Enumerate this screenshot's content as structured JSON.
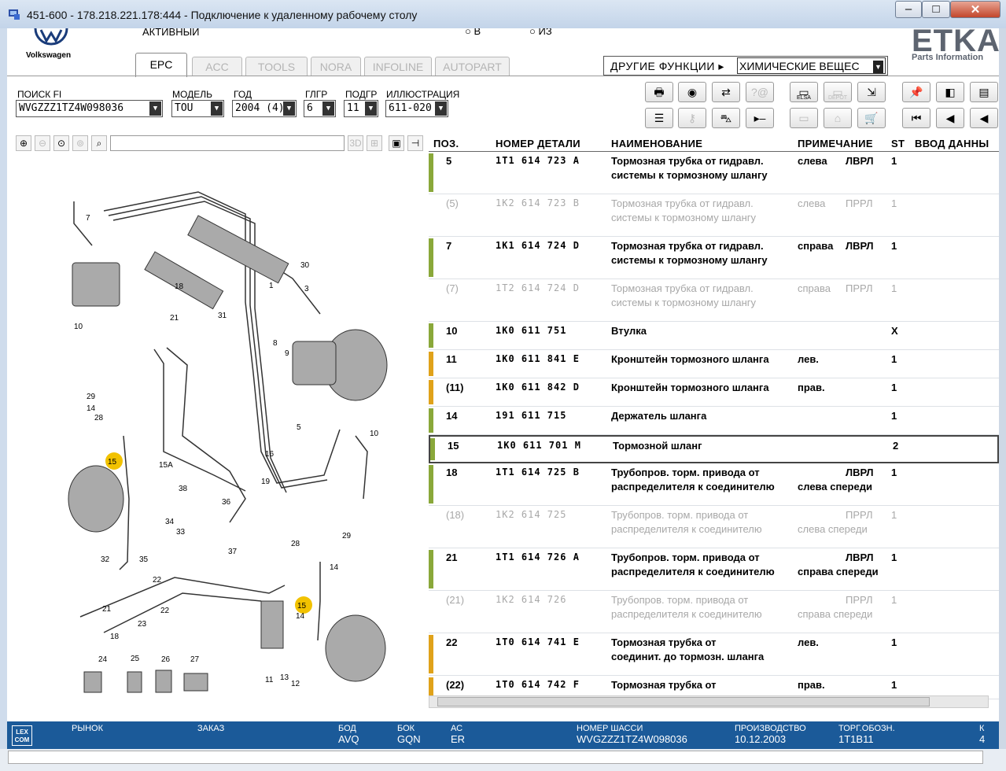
{
  "window": {
    "title": "451-600 - 178.218.221.178:444 - Подключение к удаленному рабочему столу"
  },
  "brand": {
    "name": "Volkswagen",
    "status": "АКТИВНЫЙ",
    "radio_a": "В",
    "radio_b": "ИЗ"
  },
  "etka": {
    "logo": "ETKA",
    "subtitle": "Parts Information"
  },
  "tabs": [
    "EPC",
    "ACC",
    "TOOLS",
    "NORA",
    "INFOLINE",
    "AUTOPART"
  ],
  "other_functions": {
    "label": "ДРУГИЕ ФУНКЦИИ ▸",
    "value": "ХИМИЧЕСКИЕ ВЕЩЕС"
  },
  "fields": {
    "search_fi": {
      "label": "ПОИСК FI",
      "value": "WVGZZZ1TZ4W098036"
    },
    "model": {
      "label": "МОДЕЛЬ",
      "value": "TOU"
    },
    "year": {
      "label": "ГОД",
      "value": "2004 (4)"
    },
    "glgr": {
      "label": "ГЛГР",
      "value": "6"
    },
    "podgr": {
      "label": "ПОДГР",
      "value": "11"
    },
    "illustration": {
      "label": "ИЛЛЮСТРАЦИЯ",
      "value": "611-020"
    }
  },
  "toolbar": {
    "elsa": "ELSA",
    "depot": "DEPOT"
  },
  "table": {
    "headers": [
      "ПОЗ.",
      "НОМЕР ДЕТАЛИ",
      "НАИМЕНОВАНИЕ",
      "ПРИМЕЧАНИЕ",
      "ST",
      "ВВОД ДАННЫ"
    ],
    "rows": [
      {
        "pos": "5",
        "num": "1T1 614 723 A",
        "n1": "Тормозная трубка от гидравл.",
        "n2": "системы к тормозному шлангу",
        "r1": "слева",
        "r2": "",
        "side": "ЛВРЛ",
        "st": "1",
        "mark": "#8aa83a",
        "grey": false
      },
      {
        "pos": "(5)",
        "num": "1K2 614 723 B",
        "n1": "Тормозная трубка от гидравл.",
        "n2": "системы к тормозному шлангу",
        "r1": "слева",
        "r2": "",
        "side": "ПРРЛ",
        "st": "1",
        "mark": "",
        "grey": true
      },
      {
        "pos": "7",
        "num": "1K1 614 724 D",
        "n1": "Тормозная трубка от гидравл.",
        "n2": "системы к тормозному шлангу",
        "r1": "справа",
        "r2": "",
        "side": "ЛВРЛ",
        "st": "1",
        "mark": "#8aa83a",
        "grey": false
      },
      {
        "pos": "(7)",
        "num": "1T2 614 724 D",
        "n1": "Тормозная трубка от гидравл.",
        "n2": "системы к тормозному шлангу",
        "r1": "справа",
        "r2": "",
        "side": "ПРРЛ",
        "st": "1",
        "mark": "",
        "grey": true
      },
      {
        "pos": "10",
        "num": "1K0 611 751",
        "n1": "Втулка",
        "n2": "",
        "r1": "",
        "r2": "",
        "side": "",
        "st": "X",
        "mark": "#8aa83a",
        "grey": false
      },
      {
        "pos": "11",
        "num": "1K0 611 841 E",
        "n1": "Кронштейн тормозного шланга",
        "n2": "",
        "r1": "лев.",
        "r2": "",
        "side": "",
        "st": "1",
        "mark": "#e0a21a",
        "grey": false
      },
      {
        "pos": "(11)",
        "num": "1K0 611 842 D",
        "n1": "Кронштейн тормозного шланга",
        "n2": "",
        "r1": "прав.",
        "r2": "",
        "side": "",
        "st": "1",
        "mark": "#e0a21a",
        "grey": false
      },
      {
        "pos": "14",
        "num": "191 611 715",
        "n1": "Держатель шланга",
        "n2": "",
        "r1": "",
        "r2": "",
        "side": "",
        "st": "1",
        "mark": "#8aa83a",
        "grey": false
      },
      {
        "pos": "15",
        "num": "1K0 611 701 M",
        "n1": "Тормозной шланг",
        "n2": "",
        "r1": "",
        "r2": "",
        "side": "",
        "st": "2",
        "mark": "#8aa83a",
        "grey": false
      },
      {
        "pos": "18",
        "num": "1T1 614 725 B",
        "n1": "Трубопров. торм. привода от",
        "n2": "распределителя к соединителю",
        "r1": "",
        "r2": "слева спереди",
        "side": "ЛВРЛ",
        "st": "1",
        "mark": "#8aa83a",
        "grey": false
      },
      {
        "pos": "(18)",
        "num": "1K2 614 725",
        "n1": "Трубопров. торм. привода от",
        "n2": "распределителя к соединителю",
        "r1": "",
        "r2": "слева спереди",
        "side": "ПРРЛ",
        "st": "1",
        "mark": "",
        "grey": true
      },
      {
        "pos": "21",
        "num": "1T1 614 726 A",
        "n1": "Трубопров. торм. привода от",
        "n2": "распределителя к соединителю",
        "r1": "",
        "r2": "справа спереди",
        "side": "ЛВРЛ",
        "st": "1",
        "mark": "#8aa83a",
        "grey": false
      },
      {
        "pos": "(21)",
        "num": "1K2 614 726",
        "n1": "Трубопров. торм. привода от",
        "n2": "распределителя к соединителю",
        "r1": "",
        "r2": "справа спереди",
        "side": "ПРРЛ",
        "st": "1",
        "mark": "",
        "grey": true
      },
      {
        "pos": "22",
        "num": "1T0 614 741 E",
        "n1": "Тормозная трубка от",
        "n2": "соединит. до тормозн. шланга",
        "r1": "лев.",
        "r2": "",
        "side": "",
        "st": "1",
        "mark": "#e0a21a",
        "grey": false
      },
      {
        "pos": "(22)",
        "num": "1T0 614 742 F",
        "n1": "Тормозная трубка от",
        "n2": "",
        "r1": "прав.",
        "r2": "",
        "side": "",
        "st": "1",
        "mark": "#e0a21a",
        "grey": false
      }
    ]
  },
  "statusbar": {
    "lexcom": "LEX COM",
    "market_label": "РЫНОК",
    "order_label": "ЗАКАЗ",
    "bod_label": "БОД",
    "bod": "AVQ",
    "bok_label": "БОК",
    "bok": "GQN",
    "ac_label": "АС",
    "ac": "ER",
    "chassis_label": "НОМЕР ШАССИ",
    "chassis": "WVGZZZ1TZ4W098036",
    "prod_label": "ПРОИЗВОДСТВО",
    "prod": "10.12.2003",
    "trade_label": "ТОРГ.ОБОЗН.",
    "trade": "1T1B11",
    "k_label": "К",
    "k": "4"
  },
  "diagram_labels": [
    "7",
    "30",
    "1",
    "3",
    "18",
    "31",
    "21",
    "10",
    "8",
    "9",
    "29",
    "14",
    "28",
    "15",
    "15A",
    "38",
    "36",
    "5",
    "16",
    "19",
    "10",
    "34",
    "33",
    "37",
    "32",
    "35",
    "22",
    "22",
    "21",
    "18",
    "23",
    "29",
    "28",
    "14",
    "15",
    "14",
    "11",
    "13",
    "12",
    "24",
    "25",
    "26",
    "27"
  ]
}
